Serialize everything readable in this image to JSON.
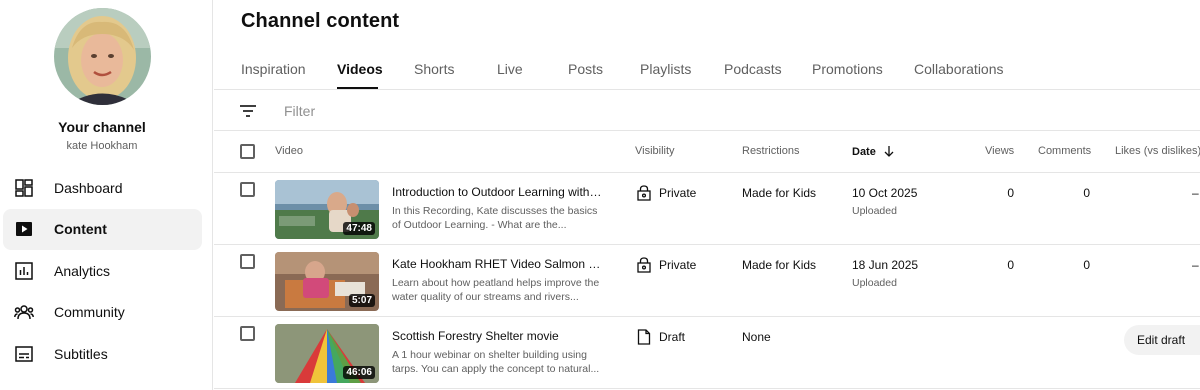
{
  "channel": {
    "title": "Your channel",
    "name": "kate Hookham"
  },
  "sidebar": {
    "items": [
      {
        "label": "Dashboard",
        "icon": "dashboard-icon"
      },
      {
        "label": "Content",
        "icon": "content-icon",
        "active": true
      },
      {
        "label": "Analytics",
        "icon": "analytics-icon"
      },
      {
        "label": "Community",
        "icon": "community-icon"
      },
      {
        "label": "Subtitles",
        "icon": "subtitles-icon"
      }
    ]
  },
  "page": {
    "title": "Channel content"
  },
  "tabs": [
    {
      "label": "Inspiration"
    },
    {
      "label": "Videos",
      "active": true
    },
    {
      "label": "Shorts"
    },
    {
      "label": "Live"
    },
    {
      "label": "Posts"
    },
    {
      "label": "Playlists"
    },
    {
      "label": "Podcasts"
    },
    {
      "label": "Promotions"
    },
    {
      "label": "Collaborations"
    }
  ],
  "filter": {
    "placeholder": "Filter"
  },
  "table": {
    "headers": {
      "video": "Video",
      "visibility": "Visibility",
      "restrictions": "Restrictions",
      "date": "Date",
      "views": "Views",
      "comments": "Comments",
      "likes": "Likes (vs dislikes)"
    },
    "rows": [
      {
        "title": "Introduction to Outdoor Learning with K...",
        "description": "In this Recording, Kate discusses the basics of Outdoor Learning. - What are the...",
        "duration": "47:48",
        "visibility": "Private",
        "restrictions": "Made for Kids",
        "date": "10 Oct 2025",
        "date_status": "Uploaded",
        "views": "0",
        "comments": "0",
        "likes": "–"
      },
      {
        "title": "Kate Hookham RHET Video Salmon Swi...",
        "description": "Learn about how peatland helps improve the water quality of our streams and rivers...",
        "duration": "5:07",
        "visibility": "Private",
        "restrictions": "Made for Kids",
        "date": "18 Jun 2025",
        "date_status": "Uploaded",
        "views": "0",
        "comments": "0",
        "likes": "–"
      },
      {
        "title": "Scottish Forestry Shelter movie",
        "description": "A 1 hour webinar on shelter building using tarps. You can apply the concept to natural...",
        "duration": "46:06",
        "visibility": "Draft",
        "restrictions": "None",
        "action_label": "Edit draft"
      }
    ]
  },
  "colors": {
    "text_primary": "#0f0f0f",
    "text_secondary": "#606060",
    "active_bg": "#f2f2f2",
    "divider": "#e5e5e5"
  }
}
